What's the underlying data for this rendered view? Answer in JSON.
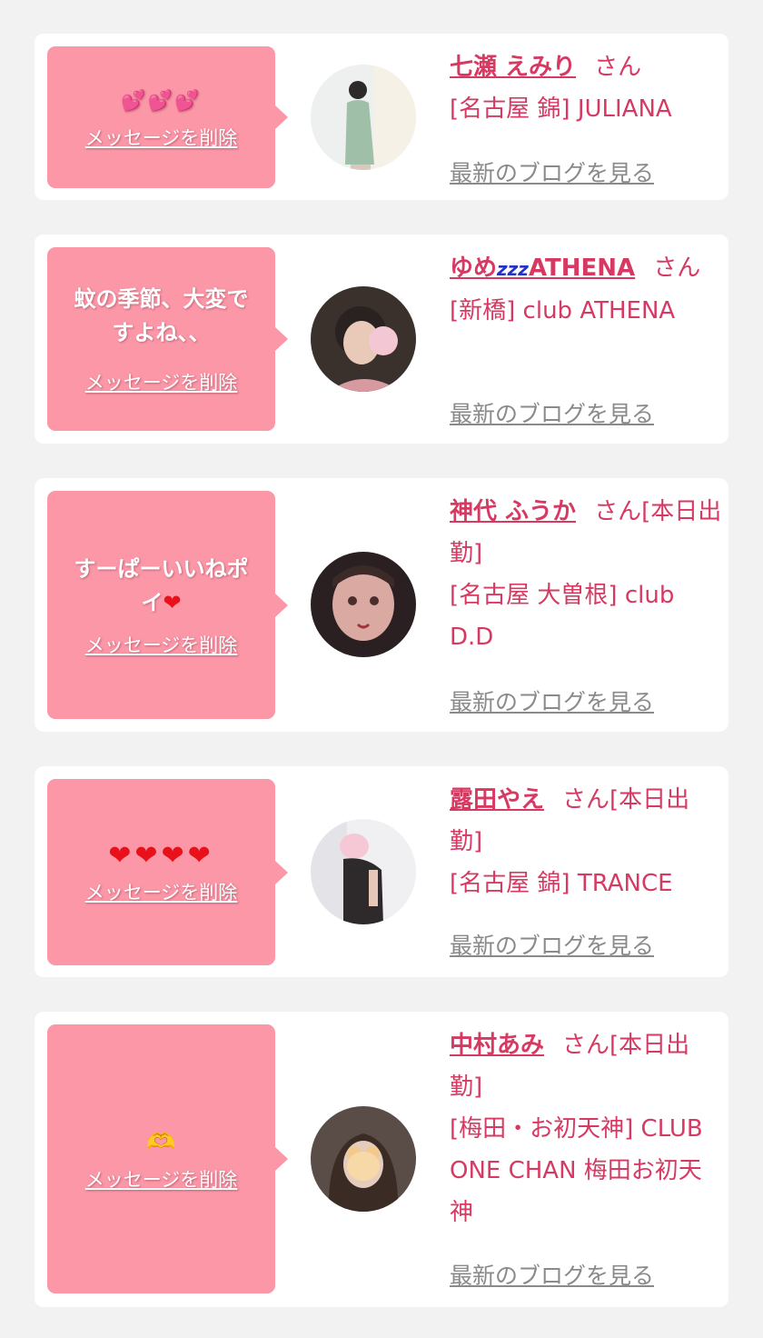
{
  "delete_label": "メッセージを削除",
  "blog_label": "最新のブログを見る",
  "cards": [
    {
      "message": "💕💕💕",
      "name": "七瀬 えみり",
      "suffix": "さん",
      "shop": "[名古屋 錦] JULIANA"
    },
    {
      "message": "蚊の季節、大変ですよね、、",
      "name_part1": "ゆめ",
      "name_zzz": "zzz",
      "name_part2": "ATHENA",
      "suffix": "さん",
      "shop": "[新橋] club ATHENA"
    },
    {
      "message": "すーぱーいいねポイ",
      "message_emoji": "❤",
      "name": "神代 ふうか",
      "suffix": "さん[本日出勤]",
      "shop": "[名古屋 大曽根] club D.D"
    },
    {
      "message": "❤❤❤❤",
      "name": "露田やえ",
      "suffix": "さん[本日出勤]",
      "shop": "[名古屋 錦] TRANCE"
    },
    {
      "message": "🫶",
      "name": "中村あみ",
      "suffix": "さん[本日出勤]",
      "shop": "[梅田・お初天神] CLUB ONE CHAN 梅田お初天神"
    }
  ],
  "colors": {
    "background": "#f2f2f3",
    "card": "#ffffff",
    "bubble": "#fb97a7",
    "accent_text": "#d63a62",
    "link_gray": "#8a8a8a",
    "heart": "#e8101a"
  }
}
